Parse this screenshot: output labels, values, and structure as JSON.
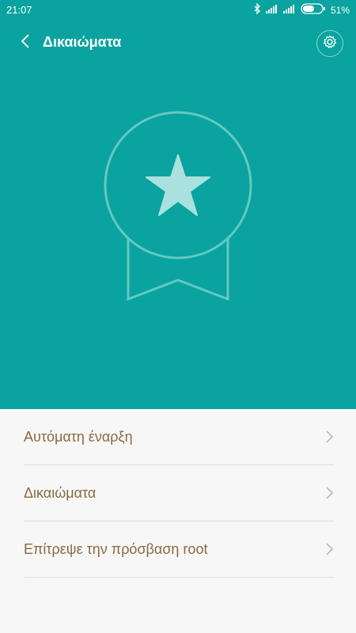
{
  "status_bar": {
    "time": "21:07",
    "battery": "51%",
    "icons": [
      "bluetooth-icon",
      "signal-icon",
      "signal-icon",
      "battery-icon"
    ]
  },
  "header": {
    "title": "Δικαιώματα",
    "back_icon": "chevron-left-icon",
    "settings_icon": "gear-icon"
  },
  "hero": {
    "background_color": "#0aa39f",
    "badge_icon": "award-star-icon"
  },
  "menu": {
    "items": [
      {
        "label": "Αυτόματη έναρξη"
      },
      {
        "label": "Δικαιώματα"
      },
      {
        "label": "Επίτρεψε την πρόσβαση root"
      }
    ],
    "label_color": "#8a6a3f"
  }
}
